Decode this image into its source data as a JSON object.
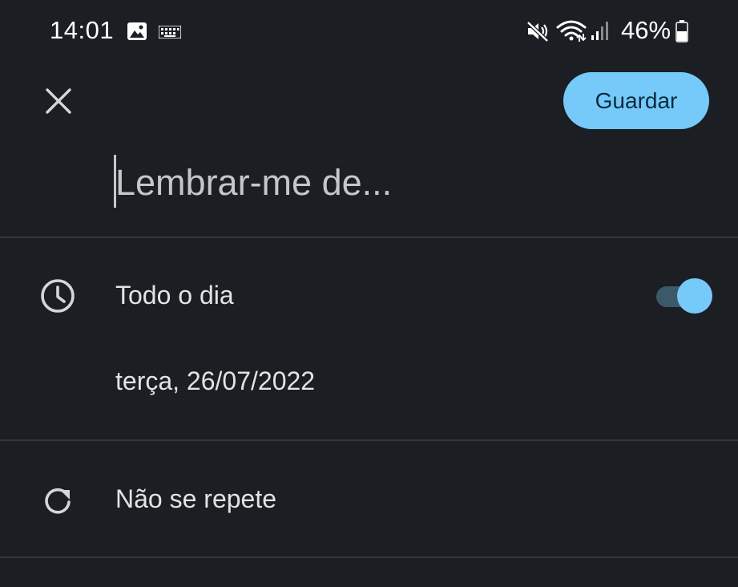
{
  "status_bar": {
    "time": "14:01",
    "battery": "46%",
    "icons": [
      "gallery-icon",
      "keyboard-icon",
      "mute-icon",
      "wifi-icon",
      "signal-icon",
      "battery-icon"
    ]
  },
  "header": {
    "close_icon": "close-icon",
    "save_label": "Guardar"
  },
  "title_field": {
    "placeholder": "Lembrar-me de...",
    "value": ""
  },
  "all_day": {
    "icon": "clock-icon",
    "label": "Todo o dia",
    "enabled": true
  },
  "date": {
    "label": "terça, 26/07/2022"
  },
  "repeat": {
    "icon": "repeat-icon",
    "label": "Não se repete"
  },
  "colors": {
    "background": "#1b1e22",
    "accent": "#75cafa",
    "divider": "#34373c",
    "text": "#e3e3e3"
  }
}
